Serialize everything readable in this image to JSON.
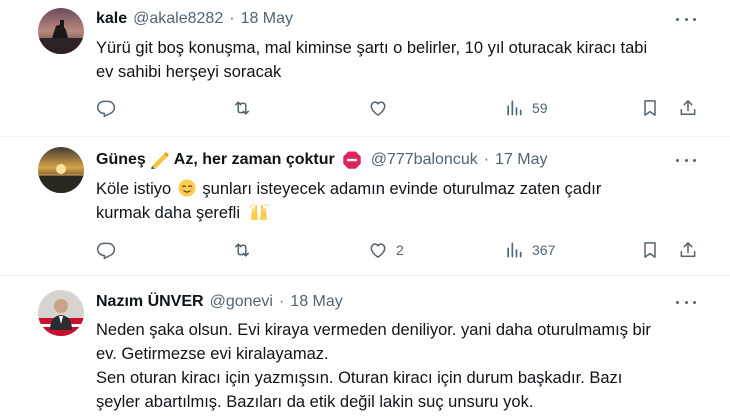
{
  "tweets": [
    {
      "name": "kale",
      "handle": "@akale8282",
      "sep": "·",
      "date": "18 May",
      "lines": [
        "Yürü git boş konuşma, mal kiminse şartı o belirler, 10 yıl oturacak kiracı tabi",
        "ev sahibi herşeyi soracak"
      ],
      "replies": "",
      "retweets": "",
      "likes": "",
      "views": "59"
    },
    {
      "name": "Güneş",
      "name2": "Az, her zaman çoktur",
      "handle": "@777baloncuk",
      "sep": "·",
      "date": "17 May",
      "line1_a": "Köle istiyo",
      "line1_b": "şunları isteyecek adamın evinde oturulmaz zaten çadır",
      "line2": "kurmak daha şerefli",
      "replies": "",
      "retweets": "",
      "likes": "2",
      "views": "367"
    },
    {
      "name": "Nazım ÜNVER",
      "handle": "@gonevi",
      "sep": "·",
      "date": "18 May",
      "lines": [
        "Neden şaka olsun. Evi kiraya vermeden deniliyor. yani daha oturulmamış bir",
        "ev. Getirmezse evi kiralayamaz.",
        "Sen oturan kiracı için yazmışsın. Oturan kiracı için durum başkadır. Bazı",
        "şeyler abartılmış. Bazıları da etik değil lakin suç unsuru yok."
      ]
    }
  ],
  "icons": {
    "reply": "reply-icon",
    "retweet": "retweet-icon",
    "like": "heart-icon",
    "views": "views-icon",
    "bookmark": "bookmark-icon",
    "share": "share-icon",
    "more": "more-icon"
  },
  "colors": {
    "text": "#0f1419",
    "secondary": "#536471",
    "divider": "#eff3f4",
    "stop": "#e0245e"
  }
}
